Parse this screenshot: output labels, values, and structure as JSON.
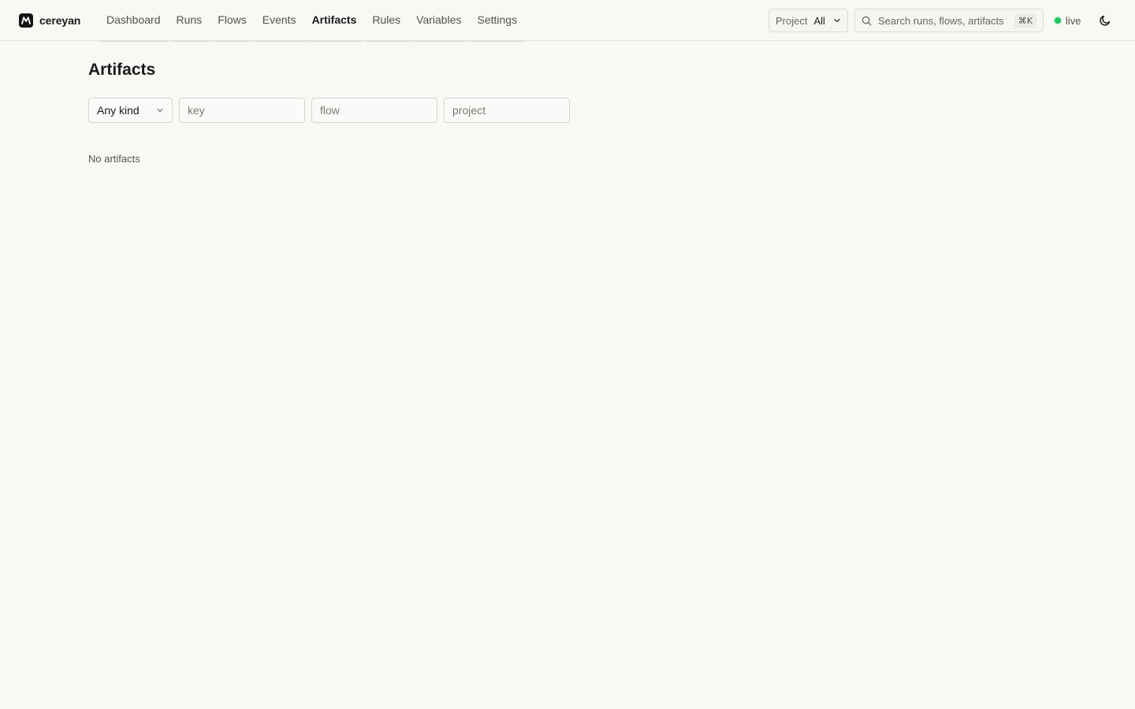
{
  "brand": {
    "name": "cereyan",
    "logo_icon": "m-logo-icon"
  },
  "nav": {
    "items": [
      {
        "label": "Dashboard",
        "active": false
      },
      {
        "label": "Runs",
        "active": false
      },
      {
        "label": "Flows",
        "active": false
      },
      {
        "label": "Events",
        "active": false
      },
      {
        "label": "Artifacts",
        "active": true
      },
      {
        "label": "Rules",
        "active": false
      },
      {
        "label": "Variables",
        "active": false
      },
      {
        "label": "Settings",
        "active": false
      }
    ]
  },
  "project_selector": {
    "label": "Project",
    "value": "All"
  },
  "search": {
    "placeholder": "Search runs, flows, artifacts",
    "shortcut": "⌘K"
  },
  "status": {
    "label": "live",
    "color": "#22c55e"
  },
  "theme_toggle": {
    "icon": "moon-icon"
  },
  "page": {
    "title": "Artifacts"
  },
  "filters": {
    "kind": {
      "value": "Any kind"
    },
    "key": {
      "placeholder": "key",
      "value": ""
    },
    "flow": {
      "placeholder": "flow",
      "value": ""
    },
    "project": {
      "placeholder": "project",
      "value": ""
    }
  },
  "empty_state": {
    "message": "No artifacts"
  }
}
